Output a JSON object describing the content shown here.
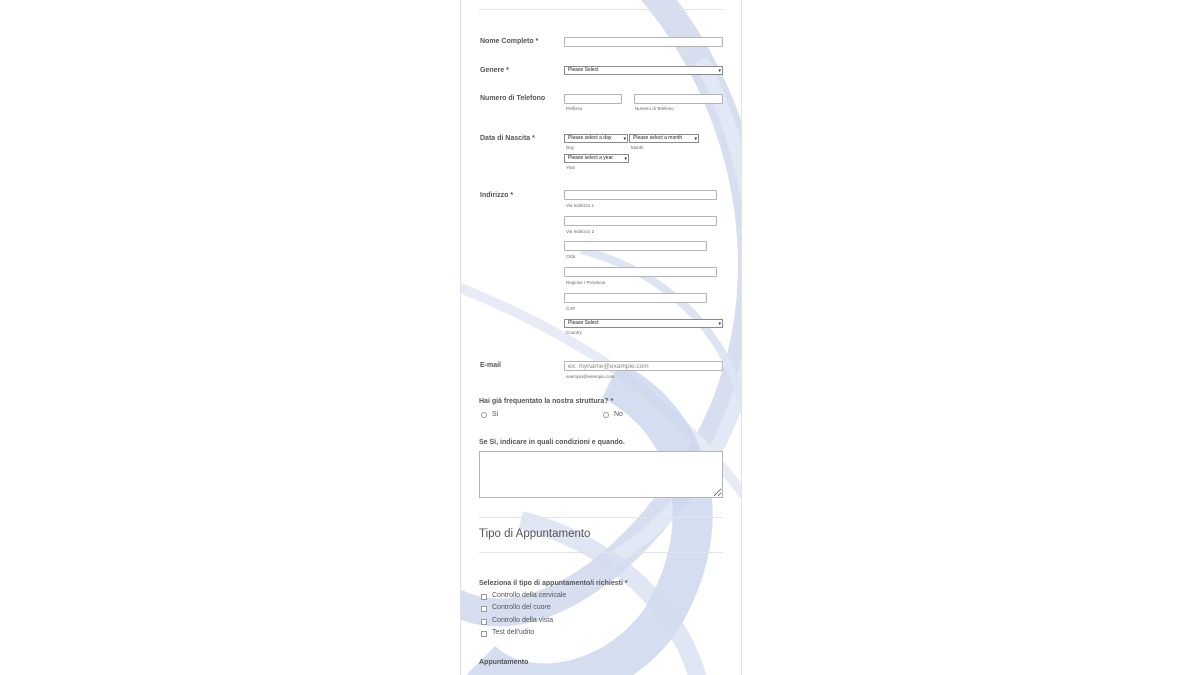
{
  "form": {
    "full_name": {
      "label": "Nome Completo",
      "required": "*"
    },
    "gender": {
      "label": "Genere",
      "required": "*",
      "selected": "Please Select"
    },
    "phone": {
      "label": "Numero di Telefono",
      "prefix_sub": "Prefisso",
      "number_sub": "Numero di Telefono"
    },
    "birth_date": {
      "label": "Data di Nascita",
      "required": "*",
      "day": {
        "selected": "Please select a day",
        "sub": "Day"
      },
      "month": {
        "selected": "Please select a month",
        "sub": "Month"
      },
      "year": {
        "selected": "Please select a year",
        "sub": "Year"
      }
    },
    "address": {
      "label": "Indirizzo",
      "required": "*",
      "line1_sub": "Via Indirizzo 1",
      "line2_sub": "Via Indirizzo 2",
      "city_sub": "Città",
      "region_sub": "Regione / Provincia",
      "zip_sub": "CAP",
      "country": {
        "selected": "Please Select",
        "sub": "Country"
      }
    },
    "email": {
      "label": "E-mail",
      "placeholder": "ex: myname@example.com",
      "sub": "esempio@esempio.com"
    },
    "visited": {
      "question": "Hai già frequentato la nostra struttura?",
      "required": "*",
      "options": [
        "Sì",
        "No"
      ]
    },
    "conditions": {
      "label": "Se Sì, indicare in quali condizioni e quando."
    },
    "appointment_type": {
      "section_title": "Tipo di Appuntamento",
      "question": "Seleziona il tipo di appuntamento/i richiesti",
      "required": "*",
      "options": [
        "Controllo della cervicale",
        "Controllo del cuore",
        "Controllo della vista",
        "Test dell'udito"
      ]
    },
    "appointment": {
      "label": "Appuntamento"
    }
  },
  "colors": {
    "accent_swirl": "#c9d4ec",
    "text": "#555555",
    "border": "#b4b4b4"
  }
}
